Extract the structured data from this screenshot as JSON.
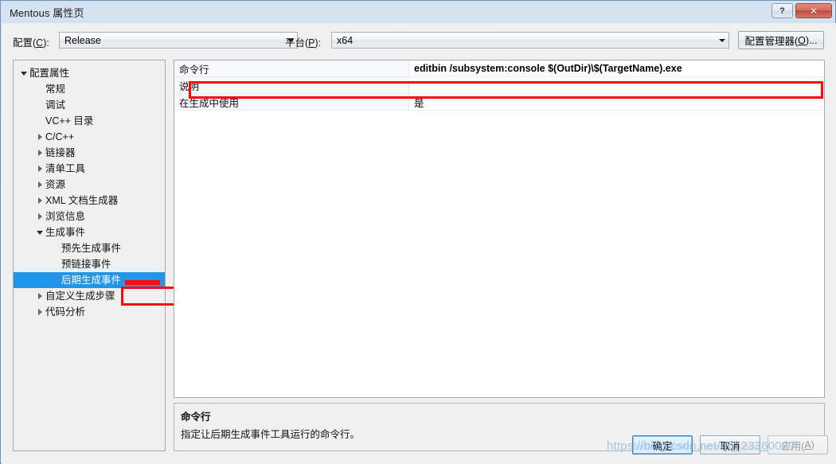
{
  "window": {
    "title": "Mentous 属性页",
    "help_button": "?",
    "close_button": "✕"
  },
  "toolbar": {
    "configuration_label_pre": "配置(",
    "configuration_label_key": "C",
    "configuration_label_post": "):",
    "configuration_value": "Release",
    "platform_label_pre": "平台(",
    "platform_label_key": "P",
    "platform_label_post": "):",
    "platform_value": "x64",
    "config_manager_pre": "配置管理器(",
    "config_manager_key": "O",
    "config_manager_post": ")..."
  },
  "tree": {
    "items": [
      {
        "label": "配置属性",
        "depth": 0,
        "glyph": "expanded",
        "selected": false
      },
      {
        "label": "常规",
        "depth": 1,
        "glyph": "none",
        "selected": false
      },
      {
        "label": "调试",
        "depth": 1,
        "glyph": "none",
        "selected": false
      },
      {
        "label": "VC++ 目录",
        "depth": 1,
        "glyph": "none",
        "selected": false
      },
      {
        "label": "C/C++",
        "depth": 1,
        "glyph": "collapsed",
        "selected": false
      },
      {
        "label": "链接器",
        "depth": 1,
        "glyph": "collapsed",
        "selected": false
      },
      {
        "label": "清单工具",
        "depth": 1,
        "glyph": "collapsed",
        "selected": false
      },
      {
        "label": "资源",
        "depth": 1,
        "glyph": "collapsed",
        "selected": false
      },
      {
        "label": "XML 文档生成器",
        "depth": 1,
        "glyph": "collapsed",
        "selected": false
      },
      {
        "label": "浏览信息",
        "depth": 1,
        "glyph": "collapsed",
        "selected": false
      },
      {
        "label": "生成事件",
        "depth": 1,
        "glyph": "expanded",
        "selected": false
      },
      {
        "label": "预先生成事件",
        "depth": 2,
        "glyph": "none",
        "selected": false
      },
      {
        "label": "预链接事件",
        "depth": 2,
        "glyph": "none",
        "selected": false
      },
      {
        "label": "后期生成事件",
        "depth": 2,
        "glyph": "none",
        "selected": true
      },
      {
        "label": "自定义生成步骤",
        "depth": 1,
        "glyph": "collapsed",
        "selected": false
      },
      {
        "label": "代码分析",
        "depth": 1,
        "glyph": "collapsed",
        "selected": false
      }
    ]
  },
  "grid": {
    "rows": [
      {
        "name": "命令行",
        "value": "editbin /subsystem:console $(OutDir)\\$(TargetName).exe",
        "bold": true,
        "highlighted": true
      },
      {
        "name": "说明",
        "value": "",
        "bold": false,
        "highlighted": false
      },
      {
        "name": "在生成中使用",
        "value": "是",
        "bold": false,
        "highlighted": false
      }
    ]
  },
  "description": {
    "title": "命令行",
    "body": "指定让后期生成事件工具运行的命令行。"
  },
  "footer": {
    "ok": "确定",
    "cancel": "取消",
    "apply_pre": "应用(",
    "apply_key": "A",
    "apply_post": ")"
  },
  "watermark": {
    "text": "https://blog.csdn.net/qq_23360027"
  },
  "colors": {
    "selection_blue": "#2196e8",
    "annotation_red": "#fb0a09",
    "title_gradient_top": "#d3e1f1",
    "grid_label_bg": "#f7f8fb"
  }
}
